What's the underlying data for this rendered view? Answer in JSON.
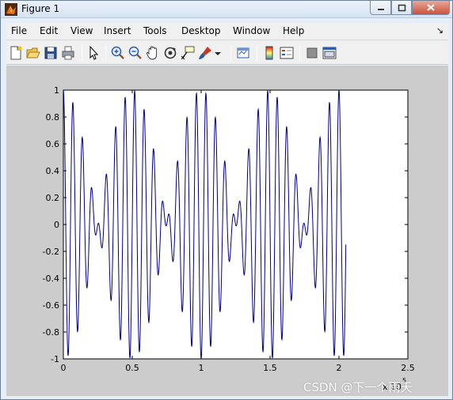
{
  "window": {
    "title": "Figure 1",
    "controls": {
      "minimize": "minimize",
      "maximize": "maximize",
      "close": "close"
    }
  },
  "menubar": {
    "items": [
      "File",
      "Edit",
      "View",
      "Insert",
      "Tools",
      "Desktop",
      "Window",
      "Help"
    ],
    "dock_arrow": "↘"
  },
  "toolbar": {
    "tools": [
      "new-figure-icon",
      "open-file-icon",
      "save-icon",
      "print-icon",
      "edit-plot-icon",
      "zoom-in-icon",
      "zoom-out-icon",
      "pan-icon",
      "rotate-3d-icon",
      "data-cursor-icon",
      "brush-icon",
      "link-plot-icon",
      "colorbar-icon",
      "legend-icon",
      "hide-plot-tools-icon",
      "show-plot-tools-icon"
    ]
  },
  "chart_data": {
    "type": "line",
    "title": "",
    "xlabel": "",
    "ylabel": "",
    "xlim": [
      0,
      2.5
    ],
    "ylim": [
      -1,
      1
    ],
    "x_exponent_label": "x 10",
    "x_exponent_power": "5",
    "x_ticks": [
      "0",
      "0.5",
      "1",
      "1.5",
      "2",
      "2.5"
    ],
    "y_ticks": [
      "1",
      "0.8",
      "0.6",
      "0.4",
      "0.2",
      "0",
      "-0.2",
      "-0.4",
      "-0.6",
      "-0.8",
      "-1"
    ],
    "series": [
      {
        "color": "#00008b",
        "x_range": [
          0,
          2.05
        ],
        "components": [
          {
            "frequency": 13.5,
            "amplitude": 0.5
          },
          {
            "frequency": 15.5,
            "amplitude": 0.5
          }
        ]
      }
    ],
    "grid": false,
    "legend": "none"
  },
  "watermark": "CSDN @下一个雨天"
}
